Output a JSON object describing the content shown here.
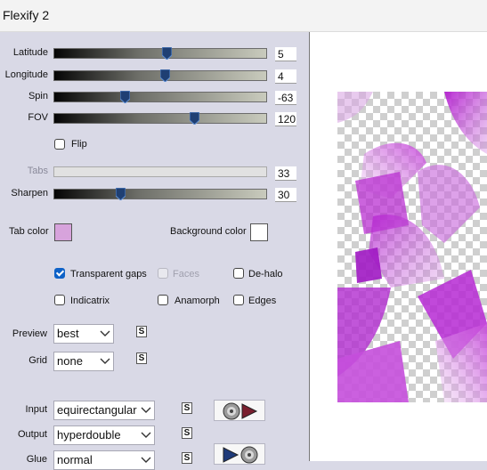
{
  "window": {
    "title": "Flexify 2"
  },
  "sliders": [
    {
      "id": "latitude",
      "label": "Latitude",
      "value": "5",
      "fraction": 0.53
    },
    {
      "id": "longitude",
      "label": "Longitude",
      "value": "4",
      "fraction": 0.52
    },
    {
      "id": "spin",
      "label": "Spin",
      "value": "-63",
      "fraction": 0.33
    },
    {
      "id": "fov",
      "label": "FOV",
      "value": "120",
      "fraction": 0.66
    },
    {
      "id": "tabs",
      "label": "Tabs",
      "value": "33",
      "fraction": null,
      "disabled": true
    },
    {
      "id": "sharpen",
      "label": "Sharpen",
      "value": "30",
      "fraction": 0.31
    }
  ],
  "flip": {
    "label": "Flip",
    "checked": false
  },
  "colors": {
    "tab_color_label": "Tab color",
    "tab_color": "#d7a3dc",
    "background_color_label": "Background color",
    "background_color": "#ffffff"
  },
  "options": {
    "transparent_gaps": "Transparent gaps",
    "faces": "Faces",
    "de_halo": "De-halo",
    "indicatrix": "Indicatrix",
    "anamorph": "Anamorph",
    "edges": "Edges"
  },
  "preview": {
    "label": "Preview",
    "value": "best"
  },
  "grid": {
    "label": "Grid",
    "value": "none"
  },
  "input": {
    "label": "Input",
    "value": "equirectangular"
  },
  "output": {
    "label": "Output",
    "value": "hyperdouble"
  },
  "glue": {
    "label": "Glue",
    "value": "normal"
  },
  "small_button_glyph": "S",
  "accent": "#0f62c7",
  "preview_color": "#c040d0"
}
